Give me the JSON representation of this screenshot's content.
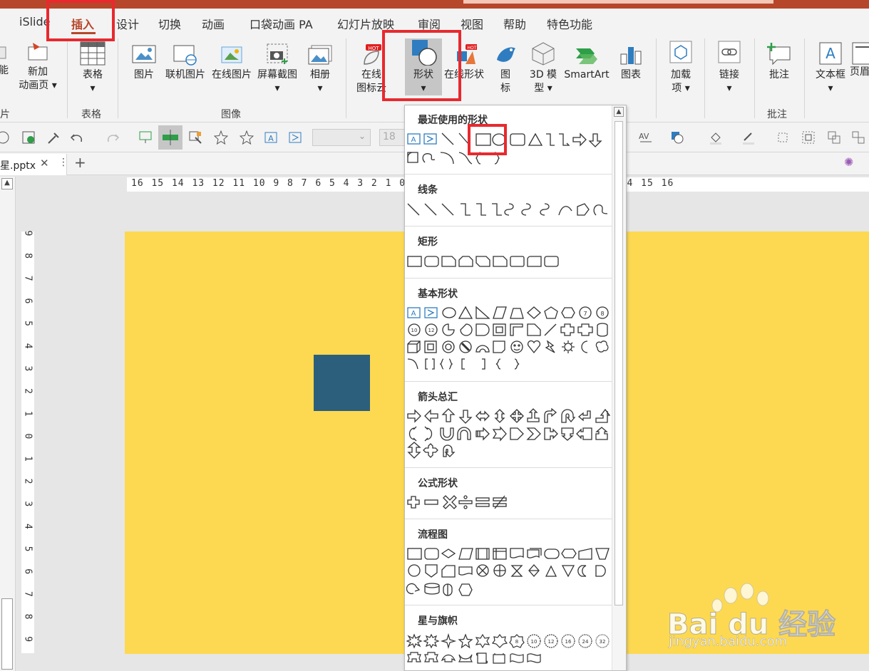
{
  "tabs": [
    "iSlide",
    "插入",
    "设计",
    "切换",
    "动画",
    "口袋动画 PA",
    "幻灯片放映",
    "审阅",
    "视图",
    "帮助",
    "特色功能"
  ],
  "active_tab": "插入",
  "ribbon": {
    "partial_left": {
      "line1": "能",
      "line2": "片"
    },
    "new_anim": {
      "line1": "新加",
      "line2": "动画页 ▾"
    },
    "table": "表格",
    "group_table": "表格",
    "picture": "图片",
    "linked_picture": "联机图片",
    "online_picture": "在线图片",
    "screenshot": "屏幕截图",
    "album": "相册",
    "group_image": "图像",
    "online_icons": {
      "line1": "在线",
      "line2": "图标云"
    },
    "shapes": "形状",
    "online_shapes": "在线形状",
    "icons": {
      "line1": "图",
      "line2": "标"
    },
    "model3d": {
      "line1": "3D 模",
      "line2": "型 ▾"
    },
    "smartart": "SmartArt",
    "chart": "图表",
    "addins": {
      "line1": "加载",
      "line2": "项 ▾"
    },
    "link": "链接",
    "comment": "批注",
    "group_comment": "批注",
    "textbox": "文本框",
    "header_partial": "页眉",
    "hot_badge": "HOT"
  },
  "qat": {
    "font_size": "18"
  },
  "doc_tab": {
    "name": "星.pptx"
  },
  "ruler": {
    "h": "16 15 14 13 12 11 10 9 8 7 6 5 4 3 2 1 0 1 2 3 4 5 6 7 8 9 10 11 12 13 14 15 16",
    "v": "9 8 7 6 5 4 3 2 1 0 1 2 3 4 5 6 7 8 9"
  },
  "shapes_panel": {
    "sections": [
      "最近使用的形状",
      "线条",
      "矩形",
      "基本形状",
      "箭头总汇",
      "公式形状",
      "流程图",
      "星与旗帜"
    ]
  },
  "watermark": {
    "brand": "Bai du 经验",
    "url": "jingyan.baidu.com"
  },
  "colors": {
    "accent": "#b7472a",
    "slide_bg": "#fdd952",
    "square": "#2c5f7b",
    "highlight": "#e8292e"
  }
}
